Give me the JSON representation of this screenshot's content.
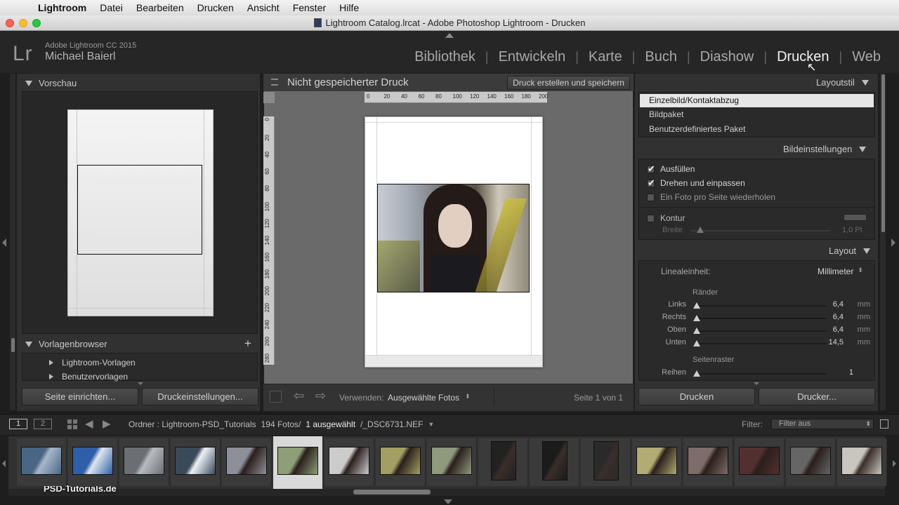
{
  "menubar": {
    "items": [
      "Lightroom",
      "Datei",
      "Bearbeiten",
      "Drucken",
      "Ansicht",
      "Fenster",
      "Hilfe"
    ]
  },
  "window": {
    "title": "Lightroom Catalog.lrcat - Adobe Photoshop Lightroom - Drucken"
  },
  "identity": {
    "logo": "Lr",
    "version": "Adobe Lightroom CC 2015",
    "user": "Michael Baierl"
  },
  "modules": [
    "Bibliothek",
    "Entwickeln",
    "Karte",
    "Buch",
    "Diashow",
    "Drucken",
    "Web"
  ],
  "left": {
    "preview_title": "Vorschau",
    "templates_title": "Vorlagenbrowser",
    "templates": [
      "Lightroom-Vorlagen",
      "Benutzervorlagen"
    ],
    "page_setup": "Seite einrichten...",
    "print_settings": "Druckeinstellungen..."
  },
  "center": {
    "doc_title": "Nicht gespeicherter Druck",
    "save_button": "Druck erstellen und speichern",
    "h_ruler": [
      "0",
      "20",
      "40",
      "60",
      "80",
      "100",
      "120",
      "140",
      "160",
      "180",
      "200"
    ],
    "v_ruler": [
      "0",
      "20",
      "40",
      "60",
      "80",
      "100",
      "120",
      "140",
      "160",
      "180",
      "200",
      "220",
      "240",
      "260",
      "280"
    ],
    "use_label": "Verwenden:",
    "use_value": "Ausgewählte Fotos",
    "page_info": "Seite 1 von 1"
  },
  "right": {
    "layout_style_title": "Layoutstil",
    "layout_styles": [
      "Einzelbild/Kontaktabzug",
      "Bildpaket",
      "Benutzerdefiniertes Paket"
    ],
    "layout_style_selected_index": 0,
    "image_settings_title": "Bildeinstellungen",
    "image_options": [
      {
        "label": "Ausfüllen",
        "checked": true
      },
      {
        "label": "Drehen und einpassen",
        "checked": true
      },
      {
        "label": "Ein Foto pro Seite wiederholen",
        "checked": false
      }
    ],
    "contour_label": "Kontur",
    "contour_checked": false,
    "width_label": "Breite",
    "width_value": "1,0 Pt",
    "layout_title": "Layout",
    "ruler_unit_label": "Linealeinheit:",
    "ruler_unit_value": "Millimeter",
    "margins_title": "Ränder",
    "margins": [
      {
        "label": "Links",
        "value": "6,4",
        "unit": "mm"
      },
      {
        "label": "Rechts",
        "value": "6,4",
        "unit": "mm"
      },
      {
        "label": "Oben",
        "value": "6,4",
        "unit": "mm"
      },
      {
        "label": "Unten",
        "value": "14,5",
        "unit": "mm"
      }
    ],
    "grid_title": "Seitenraster",
    "rows_label": "Reihen",
    "rows_value": "1",
    "print_button": "Drucken",
    "printer_button": "Drucker..."
  },
  "filmbar": {
    "view1": "1",
    "view2": "2",
    "folder_label": "Ordner : Lightroom-PSD_Tutorials",
    "count": "194 Fotos/",
    "selected": "1 ausgewählt",
    "filename": "/_DSC6731.NEF",
    "filter_label": "Filter:",
    "filter_value": "Filter aus"
  },
  "watermark": "PSD-Tutorials.de",
  "colors": {
    "accent_close": "#fe5f57",
    "accent_min": "#febc2e",
    "accent_max": "#28c840",
    "selected_style": "#e6e6e6"
  }
}
